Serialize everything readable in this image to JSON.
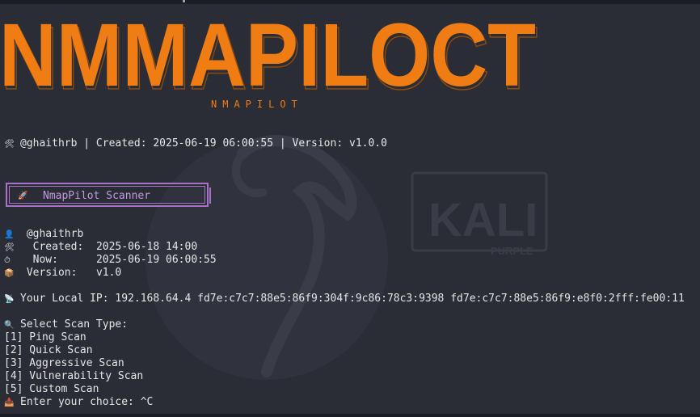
{
  "banner": {
    "title": "NMMAPILOCT",
    "subtitle": "NMAPILOT",
    "color": "#f07c14"
  },
  "meta_line": "@ghaithrb | Created: 2025-06-19 06:00:55 | Version: v1.0.0",
  "box": {
    "label": "NmapPilot Scanner",
    "color": "#a873c6"
  },
  "info": {
    "user": "@ghaithrb",
    "created_label": "Created:",
    "created": "2025-06-18 14:00",
    "now_label": "Now:",
    "now": "2025-06-19 06:00:55",
    "version_label": "Version:",
    "version": "v1.0"
  },
  "local_ip": "Your Local IP: 192.168.64.4 fd7e:c7c7:88e5:86f9:304f:9c86:78c3:9398 fd7e:c7c7:88e5:86f9:e8f0:2fff:fe00:11",
  "menu": {
    "heading": "Select Scan Type:",
    "options": [
      "[1] Ping Scan",
      "[2] Quick Scan",
      "[3] Aggressive Scan",
      "[4] Vulnerability Scan",
      "[5] Custom Scan"
    ],
    "prompt": "Enter your choice: ^C"
  },
  "wallpaper": {
    "brand": "KALI",
    "edition": "PURPLE"
  },
  "icons": [
    "hammer-wrench-icon",
    "rocket-icon",
    "user-icon",
    "stopwatch-icon",
    "package-icon",
    "satellite-icon",
    "magnifier-icon",
    "inbox-icon"
  ]
}
